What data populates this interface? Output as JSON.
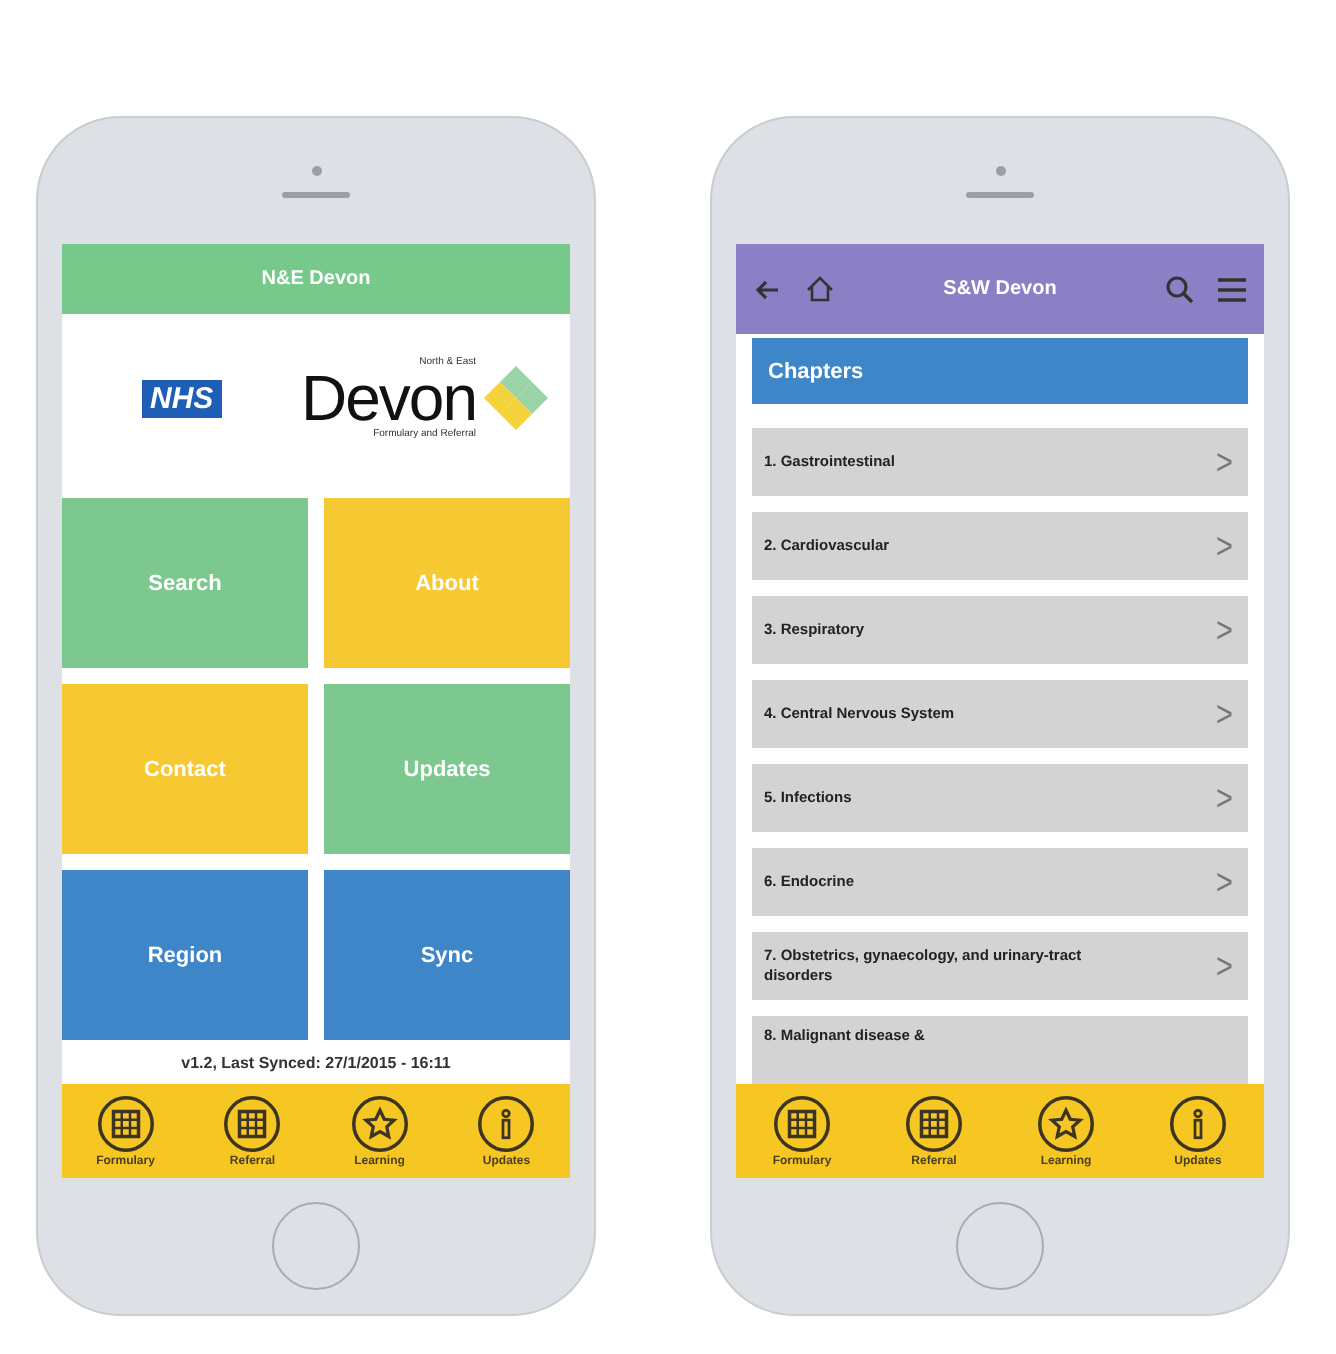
{
  "phones": [
    {
      "kind": "home",
      "header": {
        "title": "N&E Devon"
      },
      "logos": {
        "nhs": "NHS",
        "devon_top": "North & East",
        "devon": "Devon",
        "devon_sub": "Formulary and Referral"
      },
      "tiles": [
        {
          "label": "Search",
          "color": "#7dc88e"
        },
        {
          "label": "About",
          "color": "#f6c832"
        },
        {
          "label": "Contact",
          "color": "#f6c832"
        },
        {
          "label": "Updates",
          "color": "#7dc88e"
        },
        {
          "label": "Region",
          "color": "#3f86c9"
        },
        {
          "label": "Sync",
          "color": "#3f86c9"
        }
      ],
      "version": "v1.2, Last Synced: 27/1/2015 - 16:11",
      "nav": [
        {
          "label": "Formulary",
          "kind": "grid"
        },
        {
          "label": "Referral",
          "kind": "grid"
        },
        {
          "label": "Learning",
          "kind": "star"
        },
        {
          "label": "Updates",
          "kind": "info"
        }
      ]
    },
    {
      "kind": "chapters",
      "header": {
        "title": "S&W Devon"
      },
      "section": "Chapters",
      "chapters": [
        {
          "label": "1. Gastrointestinal",
          "arrow": ">"
        },
        {
          "label": "2. Cardiovascular",
          "arrow": ">"
        },
        {
          "label": "3. Respiratory",
          "arrow": ">"
        },
        {
          "label": "4. Central Nervous System",
          "arrow": ">"
        },
        {
          "label": "5. Infections",
          "arrow": ">"
        },
        {
          "label": "6. Endocrine",
          "arrow": ">"
        },
        {
          "label": "7. Obstetrics, gynaecology, and urinary-tract disorders",
          "arrow": ">"
        },
        {
          "label": "8. Malignant disease &"
        }
      ],
      "nav": [
        {
          "label": "Formulary",
          "kind": "grid"
        },
        {
          "label": "Referral",
          "kind": "grid"
        },
        {
          "label": "Learning",
          "kind": "star"
        },
        {
          "label": "Updates",
          "kind": "info"
        }
      ]
    }
  ]
}
